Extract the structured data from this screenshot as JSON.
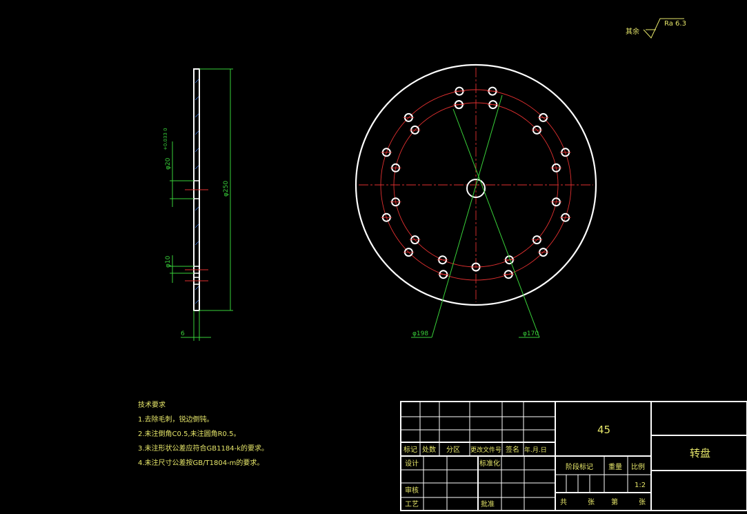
{
  "roughness": {
    "prefix": "其余",
    "value": "Ra 6.3"
  },
  "side_view": {
    "dims": {
      "hole_dia": "φ20",
      "tolerance": "+0.033\n0",
      "overall_dia": "φ250",
      "small_hole": "φ10",
      "thickness": "6"
    }
  },
  "front_view": {
    "callouts": {
      "pcd_outer": "φ198",
      "pcd_inner": "φ170"
    }
  },
  "notes": {
    "title": "技术要求",
    "items": [
      "1.去除毛刺，锐边倒钝。",
      "2.未注倒角C0.5,未注圆角R0.5。",
      "3.未注形状公差应符合GB1184-k的要求。",
      "4.未注尺寸公差按GB/T1804-m的要求。"
    ]
  },
  "title_block": {
    "material": "45",
    "part_name": "转盘",
    "rev_headers": [
      "标记",
      "处数",
      "分区",
      "更改文件号",
      "签名",
      "年.月.日"
    ],
    "design": "设计",
    "standardize": "标准化",
    "review": "审核",
    "process": "工艺",
    "approve": "批准",
    "stage_mark": "阶段标记",
    "weight": "重量",
    "scale_label": "比例",
    "scale_value": "1:2",
    "total": "共",
    "sheets": "张",
    "page": "第",
    "sheet2": "张"
  },
  "colors": {
    "outline": "#ffffff",
    "center": "#e23030",
    "dimension": "#39d23a",
    "text": "#e7e76a"
  }
}
